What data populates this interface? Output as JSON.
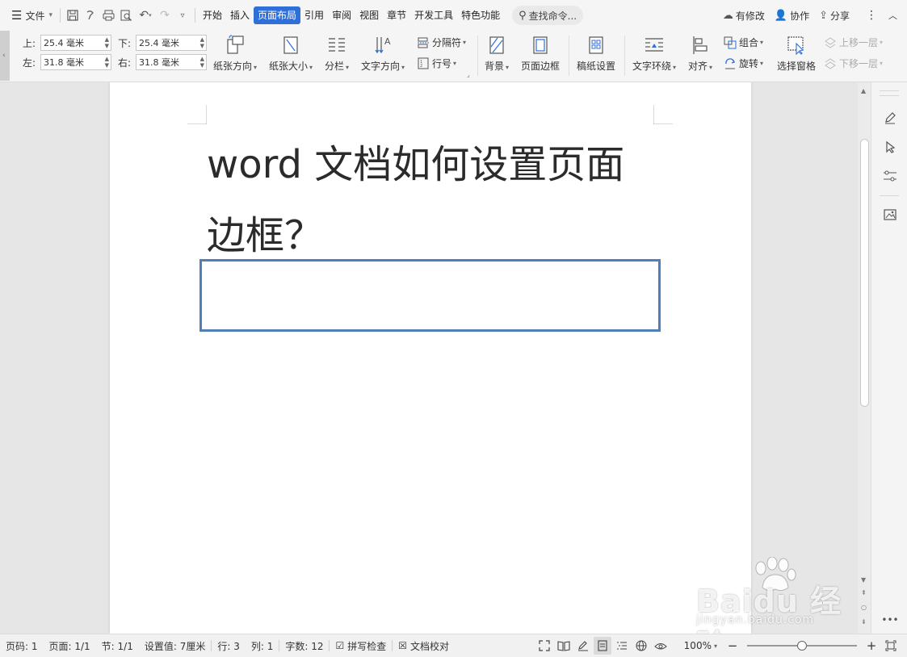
{
  "menubar": {
    "file_label": "文件",
    "tabs": [
      {
        "label": "开始",
        "active": false
      },
      {
        "label": "插入",
        "active": false
      },
      {
        "label": "页面布局",
        "active": true
      },
      {
        "label": "引用",
        "active": false
      },
      {
        "label": "审阅",
        "active": false
      },
      {
        "label": "视图",
        "active": false
      },
      {
        "label": "章节",
        "active": false
      },
      {
        "label": "开发工具",
        "active": false
      },
      {
        "label": "特色功能",
        "active": false
      }
    ],
    "search_label": "查找命令...",
    "modified_label": "有修改",
    "collaborate_label": "协作",
    "share_label": "分享"
  },
  "ribbon": {
    "margins": {
      "top_label": "上:",
      "top_value": "25.4 毫米",
      "bottom_label": "下:",
      "bottom_value": "25.4 毫米",
      "left_label": "左:",
      "left_value": "31.8 毫米",
      "right_label": "右:",
      "right_value": "31.8 毫米"
    },
    "orientation_label": "纸张方向",
    "size_label": "纸张大小",
    "columns_label": "分栏",
    "text_direction_label": "文字方向",
    "breaks_label": "分隔符",
    "line_numbers_label": "行号",
    "background_label": "背景",
    "page_border_label": "页面边框",
    "manuscript_label": "稿纸设置",
    "text_wrap_label": "文字环绕",
    "align_label": "对齐",
    "group_label": "组合",
    "rotate_label": "旋转",
    "selection_pane_label": "选择窗格",
    "bring_forward_label": "上移一层",
    "send_backward_label": "下移一层"
  },
  "document": {
    "title_line1": "word 文档如何设置页面",
    "title_line2": "边框？"
  },
  "watermark": {
    "main": "Baidu 经验",
    "sub": "jingyan.baidu.com"
  },
  "statusbar": {
    "page_code": "页码: 1",
    "pages": "页面: 1/1",
    "section": "节: 1/1",
    "setting": "设置值: 7厘米",
    "row": "行: 3",
    "col": "列: 1",
    "word_count": "字数: 12",
    "spell_check": "拼写检查",
    "doc_proof": "文档校对",
    "zoom": "100%",
    "zoom_fraction": 0.5
  },
  "colors": {
    "accent": "#2f6fd8",
    "page_border": "#4e7fb9"
  }
}
